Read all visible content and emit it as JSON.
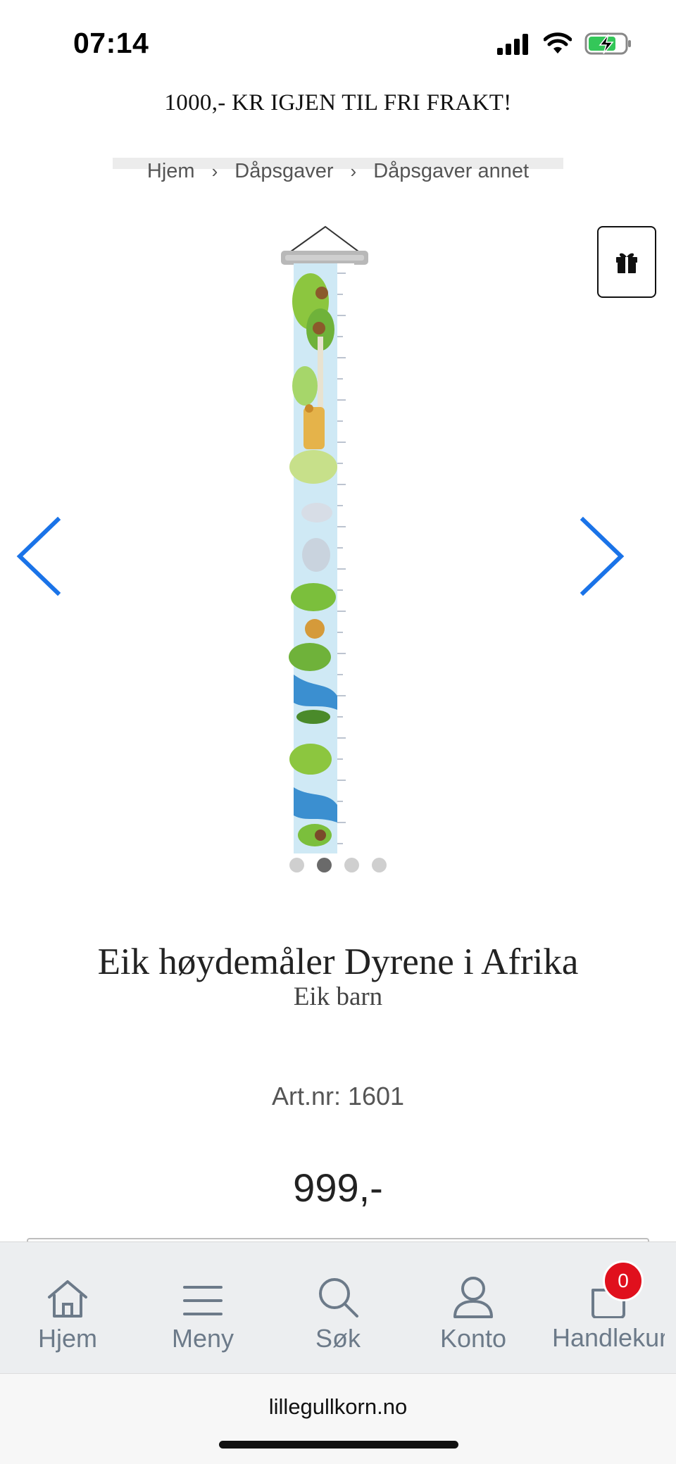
{
  "status_bar": {
    "time": "07:14"
  },
  "banner": {
    "text": "1000,- KR IGJEN TIL FRI FRAKT!"
  },
  "breadcrumb": [
    "Hjem",
    "Dåpsgaver",
    "Dåpsgaver annet"
  ],
  "product": {
    "title": "Eik høydemåler Dyrene i Afrika",
    "brand": "Eik barn",
    "artnr_label": "Art.nr:",
    "artnr_value": "1601",
    "price": "999,-"
  },
  "carousel": {
    "total": 4,
    "active_index": 1
  },
  "bottom_nav": {
    "items": [
      {
        "label": "Hjem",
        "icon": "home-icon"
      },
      {
        "label": "Meny",
        "icon": "menu-icon"
      },
      {
        "label": "Søk",
        "icon": "search-icon"
      },
      {
        "label": "Konto",
        "icon": "user-icon"
      },
      {
        "label": "Handlekurv",
        "icon": "cart-icon"
      }
    ],
    "cart_count": "0"
  },
  "browser": {
    "url": "lillegullkorn.no"
  },
  "colors": {
    "accent": "#1a73e8",
    "badge": "#e0101d",
    "nav_text": "#6c7a89"
  }
}
